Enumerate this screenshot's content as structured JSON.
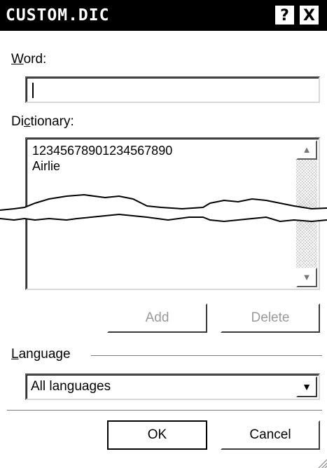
{
  "window": {
    "title": "CUSTOM.DIC",
    "help_label": "?",
    "close_label": "X"
  },
  "word": {
    "label_underlined": "W",
    "label_rest": "ord:",
    "value": ""
  },
  "dictionary": {
    "label_pre": "Di",
    "label_underlined": "c",
    "label_rest": "tionary:",
    "items": [
      "12345678901234567890",
      "Airlie"
    ],
    "scroll_up_icon": "scroll-up-arrow",
    "scroll_down_icon": "scroll-down-arrow"
  },
  "buttons": {
    "add": "Add",
    "delete": "Delete",
    "ok": "OK",
    "cancel": "Cancel"
  },
  "language": {
    "label_underlined": "L",
    "label_rest": "anguage",
    "selected": "All languages"
  }
}
